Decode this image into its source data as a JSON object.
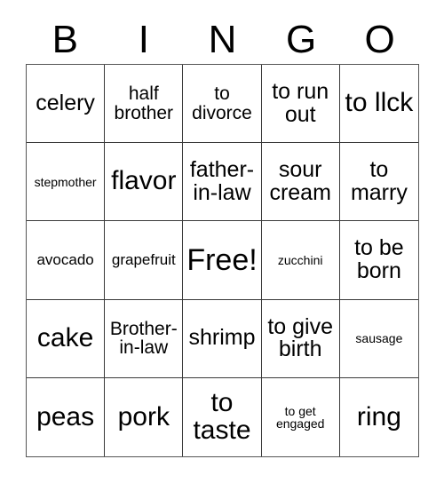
{
  "card": {
    "header_letters": [
      "B",
      "I",
      "N",
      "G",
      "O"
    ],
    "columns": 5,
    "rows": 5,
    "free_space": {
      "row": 3,
      "column": 3,
      "label": "Free!"
    },
    "colors": {
      "background": "#ffffff",
      "text": "#000000",
      "grid_line": "#3a3a3a",
      "outer_border": "#555555"
    },
    "cells": [
      [
        {
          "text": "celery",
          "size": "md"
        },
        {
          "text": "half brother",
          "size": "sm"
        },
        {
          "text": "to divorce",
          "size": "sm"
        },
        {
          "text": "to run out",
          "size": "md"
        },
        {
          "text": "to llck",
          "size": "lg"
        }
      ],
      [
        {
          "text": "stepmother",
          "size": "xxs"
        },
        {
          "text": "flavor",
          "size": "lg"
        },
        {
          "text": "father-in-law",
          "size": "md"
        },
        {
          "text": "sour cream",
          "size": "md"
        },
        {
          "text": "to marry",
          "size": "md"
        }
      ],
      [
        {
          "text": "avocado",
          "size": "xs"
        },
        {
          "text": "grapefruit",
          "size": "xs"
        },
        {
          "text": "Free!",
          "size": "xl"
        },
        {
          "text": "zucchini",
          "size": "xxs"
        },
        {
          "text": "to be born",
          "size": "md"
        }
      ],
      [
        {
          "text": "cake",
          "size": "lg"
        },
        {
          "text": "Brother-in-law",
          "size": "sm"
        },
        {
          "text": "shrimp",
          "size": "md"
        },
        {
          "text": "to give birth",
          "size": "md"
        },
        {
          "text": "sausage",
          "size": "xxs"
        }
      ],
      [
        {
          "text": "peas",
          "size": "lg"
        },
        {
          "text": "pork",
          "size": "lg"
        },
        {
          "text": "to taste",
          "size": "lg"
        },
        {
          "text": "to get engaged",
          "size": "xxs"
        },
        {
          "text": "ring",
          "size": "lg"
        }
      ]
    ]
  }
}
